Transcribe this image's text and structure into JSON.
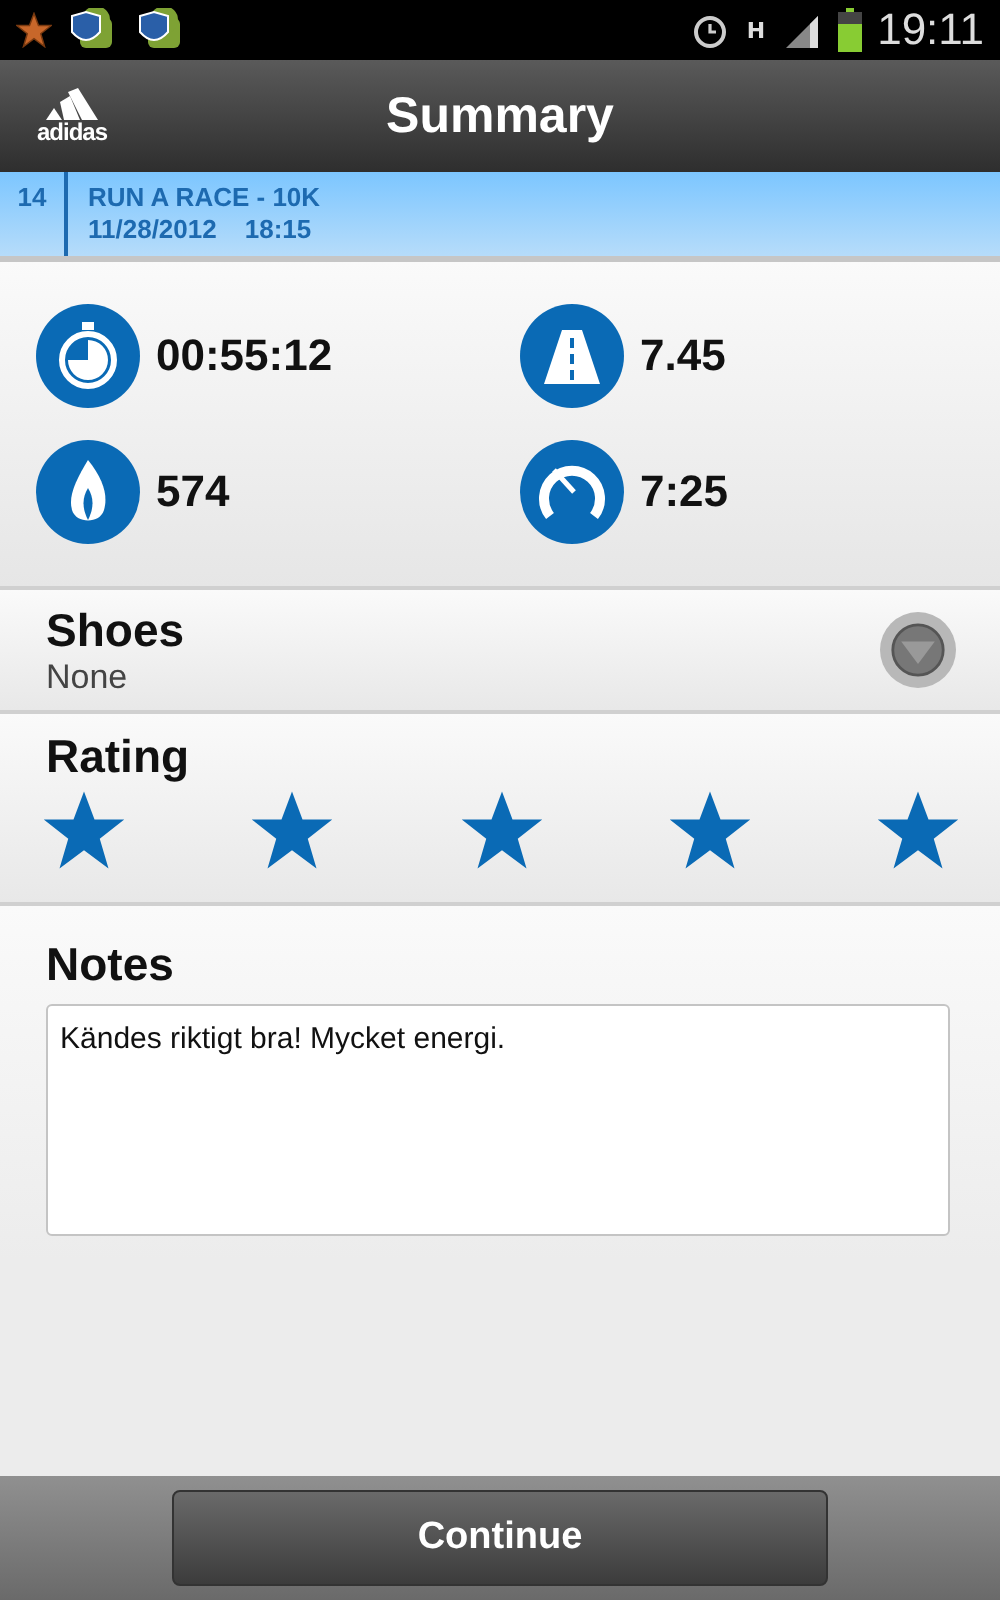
{
  "status_bar": {
    "network": "H",
    "time": "19:11"
  },
  "app_bar": {
    "logo": "adidas",
    "title": "Summary"
  },
  "workout": {
    "number": "14",
    "name": "RUN A RACE - 10K",
    "date": "11/28/2012",
    "time": "18:15"
  },
  "stats": [
    {
      "kind": "duration",
      "value": "00:55:12"
    },
    {
      "kind": "distance",
      "value": "7.45"
    },
    {
      "kind": "calories",
      "value": "574"
    },
    {
      "kind": "pace",
      "value": "7:25"
    }
  ],
  "shoes": {
    "label": "Shoes",
    "value": "None"
  },
  "rating": {
    "label": "Rating",
    "stars": 5
  },
  "notes": {
    "label": "Notes",
    "value": "Kändes riktigt bra! Mycket energi."
  },
  "buttons": [
    "Continue"
  ]
}
